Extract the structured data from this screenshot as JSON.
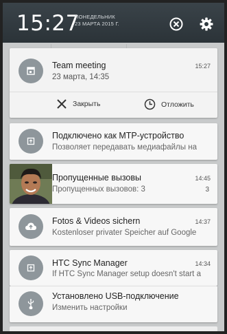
{
  "status": {
    "time": "15:27",
    "weekday": "ПОНЕДЕЛЬНИК",
    "date": "23 МАРТА 2015 Г."
  },
  "icons": {
    "close": "close-icon",
    "settings": "gear-icon"
  },
  "notifications": [
    {
      "title": "Team meeting",
      "subtitle": "23 марта, 14:35",
      "time": "15:27",
      "icon": "calendar-icon",
      "actions": [
        {
          "label": "Закрыть",
          "icon": "close-x-icon"
        },
        {
          "label": "Отложить",
          "icon": "clock-icon"
        }
      ]
    },
    {
      "title": "Подключено как MTP-устройство",
      "subtitle": "Позволяет передавать медиафайлы на",
      "icon": "usb-device-icon"
    },
    {
      "title": "Пропущенные вызовы",
      "subtitle": "Пропущенных вызовов: 3",
      "time": "14:45",
      "count": "3",
      "icon": "contact-photo"
    },
    {
      "title": "Fotos & Videos sichern",
      "subtitle": "Kostenloser privater Speicher auf Google",
      "time": "14:37",
      "icon": "cloud-upload-icon"
    },
    {
      "title": "HTC Sync Manager",
      "subtitle": "If HTC Sync Manager setup doesn't start a",
      "time": "14:34",
      "icon": "sync-device-icon"
    },
    {
      "title": "Установлено USB-подключение",
      "subtitle": "Изменить настройки",
      "icon": "usb-icon"
    }
  ],
  "colors": {
    "header_bg": "#2f3a40",
    "card_bg": "#f7f7f7",
    "icon_circle": "#8e969b"
  }
}
